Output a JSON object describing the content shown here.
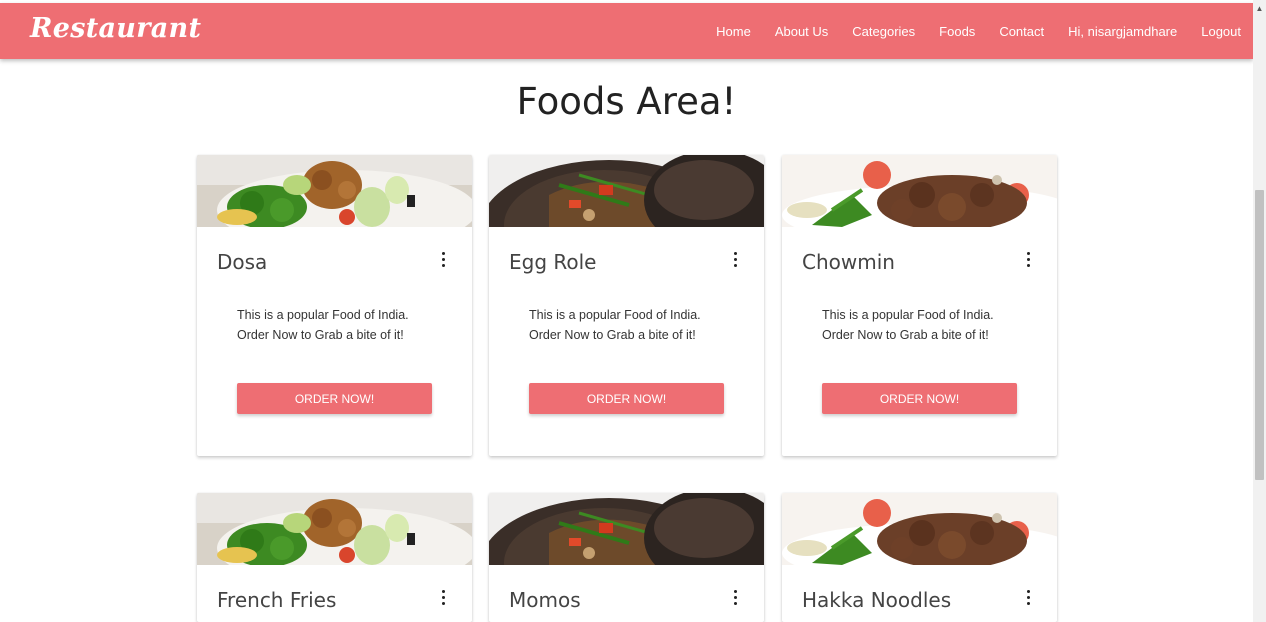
{
  "navbar": {
    "brand": "Restaurant",
    "links": [
      "Home",
      "About Us",
      "Categories",
      "Foods",
      "Contact",
      "Hi, nisargjamdhare",
      "Logout"
    ],
    "bg_color": "#ee6e73"
  },
  "page_title": "Foods Area!",
  "cards": [
    {
      "title": "Dosa",
      "image": "salad-plate",
      "desc1": "This is a popular Food of India.",
      "desc2": "Order Now to Grab a bite of it!",
      "button": "ORDER NOW!",
      "menu_icon": "more-vert-icon"
    },
    {
      "title": "Egg Role",
      "image": "stir-fry-pan",
      "desc1": "This is a popular Food of India.",
      "desc2": "Order Now to Grab a bite of it!",
      "button": "ORDER NOW!",
      "menu_icon": "more-vert-icon"
    },
    {
      "title": "Chowmin",
      "image": "grilled-meat-plate",
      "desc1": "This is a popular Food of India.",
      "desc2": "Order Now to Grab a bite of it!",
      "button": "ORDER NOW!",
      "menu_icon": "more-vert-icon"
    },
    {
      "title": "French Fries",
      "image": "salad-plate",
      "desc1": "",
      "desc2": "",
      "button": "",
      "menu_icon": "more-vert-icon"
    },
    {
      "title": "Momos",
      "image": "stir-fry-pan",
      "desc1": "",
      "desc2": "",
      "button": "",
      "menu_icon": "more-vert-icon"
    },
    {
      "title": "Hakka Noodles",
      "image": "grilled-meat-plate",
      "desc1": "",
      "desc2": "",
      "button": "",
      "menu_icon": "more-vert-icon"
    }
  ]
}
